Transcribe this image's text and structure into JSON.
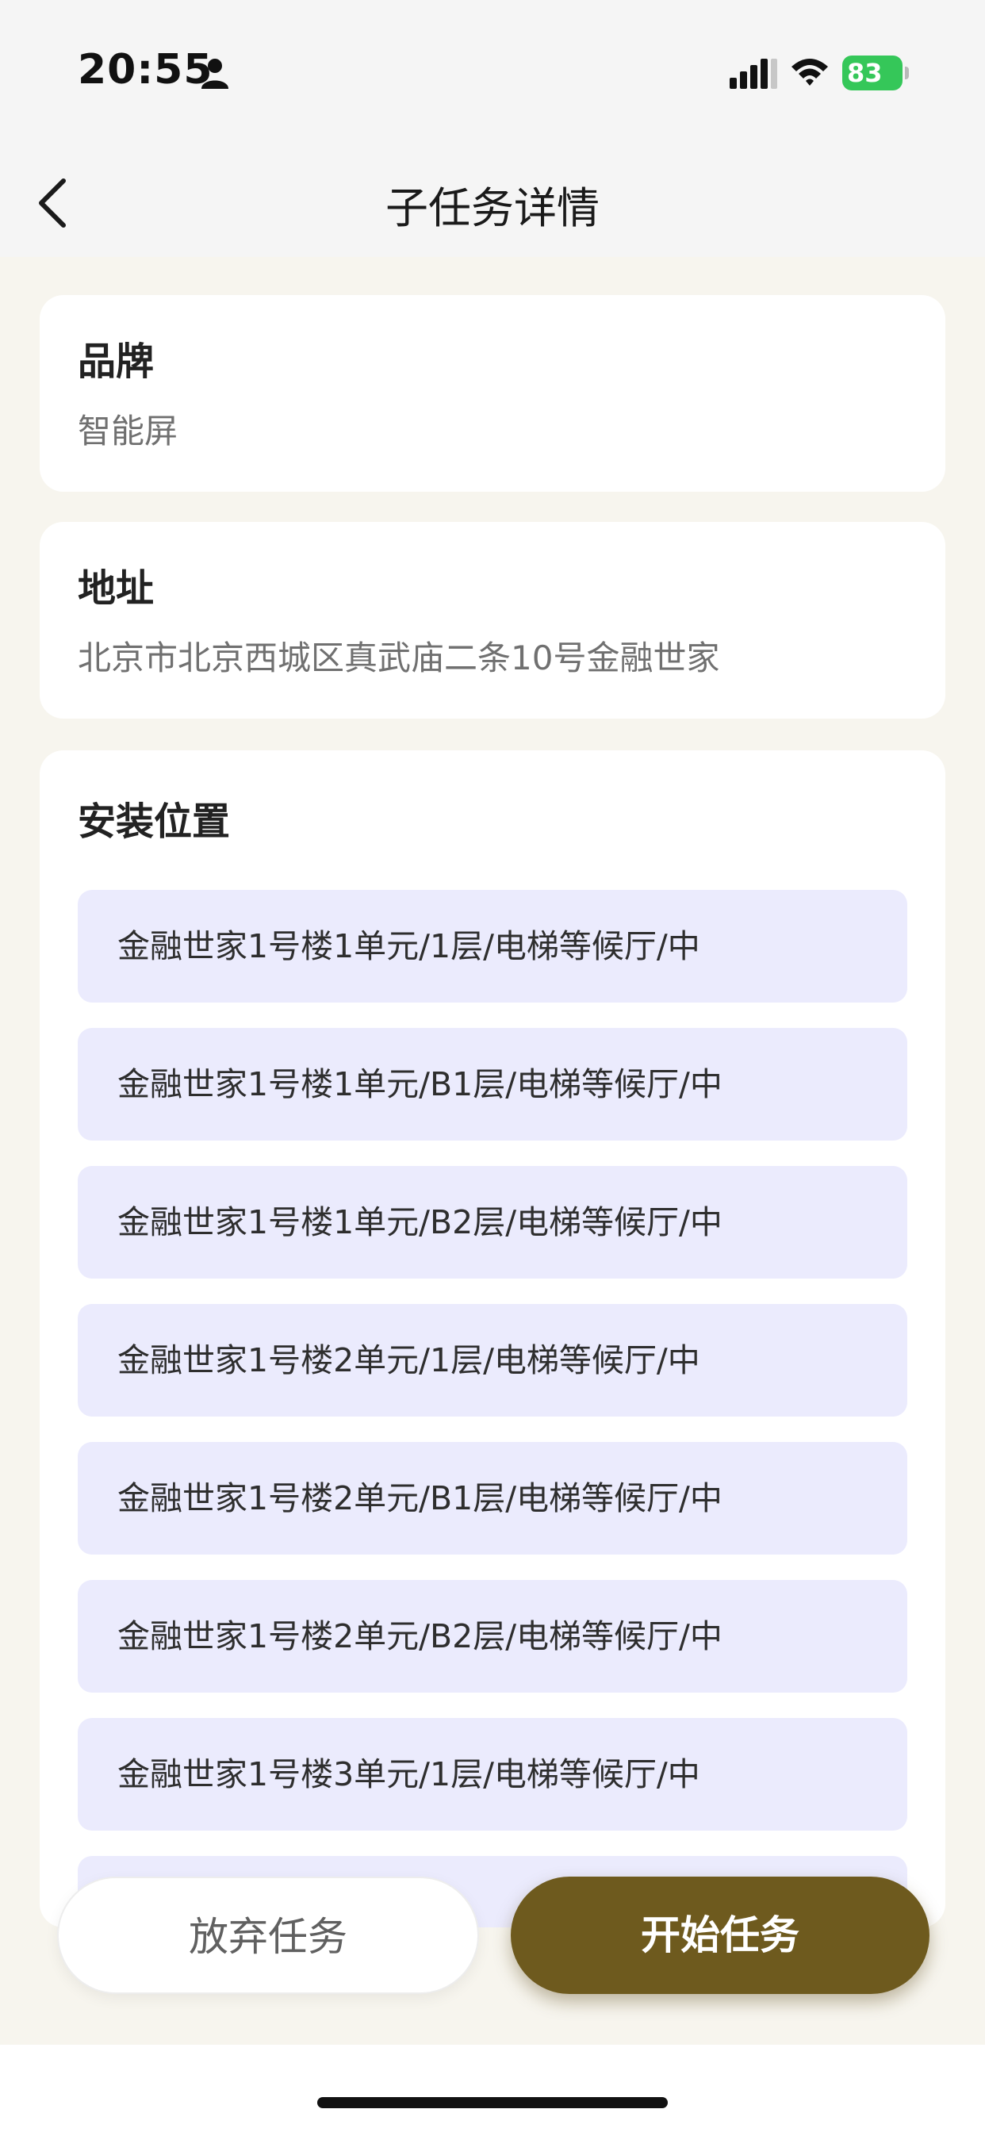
{
  "status_bar": {
    "time": "20:55",
    "battery": "83",
    "icons": [
      "person-icon",
      "signal-icon",
      "wifi-icon",
      "battery-charging-icon"
    ],
    "battery_color": "#35c759"
  },
  "nav": {
    "back_icon": "chevron-left-icon",
    "title": "子任务详情"
  },
  "brand": {
    "label": "品牌",
    "value": "智能屏"
  },
  "address": {
    "label": "地址",
    "value": "北京市北京西城区真武庙二条10号金融世家"
  },
  "locations": {
    "label": "安装位置",
    "items": [
      "金融世家1号楼1单元/1层/电梯等候厅/中",
      "金融世家1号楼1单元/B1层/电梯等候厅/中",
      "金融世家1号楼1单元/B2层/电梯等候厅/中",
      "金融世家1号楼2单元/1层/电梯等候厅/中",
      "金融世家1号楼2单元/B1层/电梯等候厅/中",
      "金融世家1号楼2单元/B2层/电梯等候厅/中",
      "金融世家1号楼3单元/1层/电梯等候厅/中",
      ""
    ],
    "item_bg": "#ebebfd"
  },
  "actions": {
    "abandon": "放弃任务",
    "start": "开始任务",
    "start_color": "#6e5a1e"
  }
}
